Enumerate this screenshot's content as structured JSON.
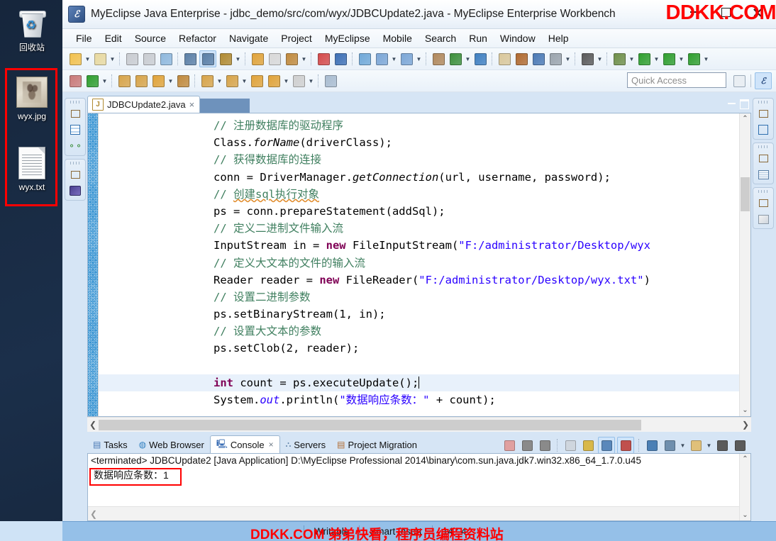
{
  "desktop": {
    "icons": [
      {
        "label": "回收站",
        "glyph": "recycle-bin"
      },
      {
        "label": "wyx.jpg",
        "glyph": "image-file"
      },
      {
        "label": "wyx.txt",
        "glyph": "text-file"
      }
    ]
  },
  "window": {
    "title": "MyEclipse Java Enterprise - jdbc_demo/src/com/wyx/JDBCUpdate2.java - MyEclipse Enterprise Workbench",
    "app_icon": "myeclipse-icon",
    "buttons": {
      "minimize": "minimize-button",
      "maximize": "maximize-button",
      "close": "close-button"
    }
  },
  "watermarks": {
    "title_bar": "DDKK.COM",
    "status_bar": "DDKK.COM 弟弟快看，程序员编程资料站"
  },
  "menu": {
    "items": [
      "File",
      "Edit",
      "Source",
      "Refactor",
      "Navigate",
      "Project",
      "MyEclipse",
      "Mobile",
      "Search",
      "Run",
      "Window",
      "Help"
    ]
  },
  "toolbar": {
    "quick_access_placeholder": "Quick Access",
    "row1": [
      {
        "name": "new-wizard",
        "color": "#f2c14e"
      },
      {
        "name": "dropdown-arrow",
        "arrow": true
      },
      {
        "name": "new-java-project",
        "color": "#e8d9a0"
      },
      {
        "name": "dropdown-arrow",
        "arrow": true
      },
      {
        "name": "separator",
        "sep": true
      },
      {
        "name": "save",
        "color": "#c9ccd1"
      },
      {
        "name": "save-all",
        "color": "#c9ccd1"
      },
      {
        "name": "print",
        "color": "#8fb8dd"
      },
      {
        "name": "separator",
        "sep": true
      },
      {
        "name": "run-mobile",
        "color": "#5b7fa6"
      },
      {
        "name": "debug-mobile",
        "color": "#5b7fa6",
        "active": true
      },
      {
        "name": "build-hammer",
        "color": "#b08a32"
      },
      {
        "name": "dropdown-arrow",
        "arrow": true
      },
      {
        "name": "separator",
        "sep": true
      },
      {
        "name": "undo",
        "color": "#e0a33a"
      },
      {
        "name": "redo",
        "color": "#d8d8d8"
      },
      {
        "name": "deploy",
        "color": "#c08a3e"
      },
      {
        "name": "dropdown-arrow",
        "arrow": true
      },
      {
        "name": "separator",
        "sep": true
      },
      {
        "name": "new-server-cube",
        "color": "#d44a4a"
      },
      {
        "name": "server-cube",
        "color": "#3c6fb5"
      },
      {
        "name": "separator",
        "sep": true
      },
      {
        "name": "web-20",
        "color": "#6fa8d8"
      },
      {
        "name": "new-diagram",
        "color": "#7ba6d6"
      },
      {
        "name": "dropdown-arrow",
        "arrow": true
      },
      {
        "name": "open-diagram",
        "color": "#7ba6d6"
      },
      {
        "name": "dropdown-arrow",
        "arrow": true
      },
      {
        "name": "separator",
        "sep": true
      },
      {
        "name": "import-project",
        "color": "#b0885c"
      },
      {
        "name": "run-server",
        "color": "#3c8f3c"
      },
      {
        "name": "dropdown-arrow",
        "arrow": true
      },
      {
        "name": "globe",
        "color": "#3e7fc1"
      },
      {
        "name": "separator",
        "sep": true
      },
      {
        "name": "clean",
        "color": "#d9c79a"
      },
      {
        "name": "refresh-reverse",
        "color": "#b06a30"
      },
      {
        "name": "report",
        "color": "#4a79b5"
      },
      {
        "name": "hidden-view",
        "color": "#9aa4ad"
      },
      {
        "name": "dropdown-arrow",
        "arrow": true
      },
      {
        "name": "separator",
        "sep": true
      },
      {
        "name": "snapshot",
        "color": "#5a5a5a"
      },
      {
        "name": "dropdown-arrow",
        "arrow": true
      },
      {
        "name": "separator",
        "sep": true
      },
      {
        "name": "debug",
        "color": "#6f8f4a"
      },
      {
        "name": "dropdown-arrow",
        "arrow": true
      },
      {
        "name": "run",
        "color": "#2f9e2f"
      },
      {
        "name": "dropdown-arrow",
        "arrow": true
      },
      {
        "name": "run-configurations",
        "color": "#2f9e2f"
      },
      {
        "name": "dropdown-arrow",
        "arrow": true
      },
      {
        "name": "run-external",
        "color": "#2f9e2f"
      },
      {
        "name": "dropdown-arrow",
        "arrow": true
      }
    ],
    "row2": [
      {
        "name": "new-table",
        "color": "#c97a7a"
      },
      {
        "name": "new-green-circle",
        "color": "#2f9e2f"
      },
      {
        "name": "dropdown-arrow",
        "arrow": true
      },
      {
        "name": "separator",
        "sep": true
      },
      {
        "name": "open-folder-green",
        "color": "#d7a44a"
      },
      {
        "name": "open-folder",
        "color": "#d7a44a"
      },
      {
        "name": "pencil",
        "color": "#e0a33a"
      },
      {
        "name": "dropdown-arrow",
        "arrow": true
      },
      {
        "name": "open-resource",
        "color": "#c08a3e"
      },
      {
        "name": "separator",
        "sep": true
      },
      {
        "name": "next-annotation",
        "color": "#d7a44a"
      },
      {
        "name": "dropdown-arrow",
        "arrow": true
      },
      {
        "name": "previous-annotation",
        "color": "#d7a44a"
      },
      {
        "name": "dropdown-arrow",
        "arrow": true
      },
      {
        "name": "back-history",
        "color": "#e0a33a"
      },
      {
        "name": "back",
        "color": "#e0a33a"
      },
      {
        "name": "dropdown-arrow",
        "arrow": true
      },
      {
        "name": "forward",
        "color": "#cfcfcf"
      },
      {
        "name": "dropdown-arrow",
        "arrow": true
      },
      {
        "name": "separator",
        "sep": true
      },
      {
        "name": "new-window",
        "color": "#a9bcd0"
      }
    ]
  },
  "left_side_icons": [
    {
      "name": "restore-view-icon"
    },
    {
      "name": "package-explorer-icon"
    },
    {
      "name": "outline-tree-icon"
    },
    {
      "name": "restore-view-icon-2"
    },
    {
      "name": "myeclipse-explorer-icon"
    }
  ],
  "right_side_icons": [
    {
      "name": "restore-view-icon"
    },
    {
      "name": "outline-icon"
    },
    {
      "name": "restore-view-icon-2"
    },
    {
      "name": "task-list-icon"
    },
    {
      "name": "restore-view-icon-3"
    },
    {
      "name": "snippets-icon"
    }
  ],
  "editor": {
    "tab_label": "JDBCUpdate2.java",
    "tab_icon": "java-file-icon",
    "tab_close": "×",
    "code_lines": [
      {
        "indent": 0,
        "tokens": [
          {
            "t": "comment",
            "v": "// "
          },
          {
            "t": "comment",
            "v": "注册数据库的驱动程序"
          }
        ]
      },
      {
        "indent": 0,
        "tokens": [
          {
            "t": "plain",
            "v": "Class."
          },
          {
            "t": "method",
            "v": "forName"
          },
          {
            "t": "plain",
            "v": "(driverClass);"
          }
        ]
      },
      {
        "indent": 0,
        "tokens": [
          {
            "t": "comment",
            "v": "// "
          },
          {
            "t": "comment",
            "v": "获得数据库的连接"
          }
        ]
      },
      {
        "indent": 0,
        "tokens": [
          {
            "t": "plain",
            "v": "conn = DriverManager."
          },
          {
            "t": "method",
            "v": "getConnection"
          },
          {
            "t": "plain",
            "v": "(url, username, password);"
          }
        ]
      },
      {
        "indent": 0,
        "tokens": [
          {
            "t": "comment",
            "v": "// "
          },
          {
            "t": "comment-spell",
            "v": "创建sql执行对象"
          }
        ]
      },
      {
        "indent": 0,
        "tokens": [
          {
            "t": "plain",
            "v": "ps = conn.prepareStatement(addSql);"
          }
        ]
      },
      {
        "indent": 0,
        "tokens": [
          {
            "t": "comment",
            "v": "// "
          },
          {
            "t": "comment",
            "v": "定义二进制文件输入流"
          }
        ]
      },
      {
        "indent": 0,
        "tokens": [
          {
            "t": "plain",
            "v": "InputStream in = "
          },
          {
            "t": "keyword",
            "v": "new"
          },
          {
            "t": "plain",
            "v": " FileInputStream("
          },
          {
            "t": "string",
            "v": "\"F:/administrator/Desktop/wyx"
          }
        ]
      },
      {
        "indent": 0,
        "tokens": [
          {
            "t": "comment",
            "v": "// "
          },
          {
            "t": "comment",
            "v": "定义大文本的文件的输入流"
          }
        ]
      },
      {
        "indent": 0,
        "tokens": [
          {
            "t": "plain",
            "v": "Reader reader = "
          },
          {
            "t": "keyword",
            "v": "new"
          },
          {
            "t": "plain",
            "v": " FileReader("
          },
          {
            "t": "string",
            "v": "\"F:/administrator/Desktop/wyx.txt\""
          },
          {
            "t": "plain",
            "v": ")"
          }
        ]
      },
      {
        "indent": 0,
        "tokens": [
          {
            "t": "comment",
            "v": "// "
          },
          {
            "t": "comment",
            "v": "设置二进制参数"
          }
        ]
      },
      {
        "indent": 0,
        "tokens": [
          {
            "t": "plain",
            "v": "ps.setBinaryStream(1, in);"
          }
        ]
      },
      {
        "indent": 0,
        "tokens": [
          {
            "t": "comment",
            "v": "// "
          },
          {
            "t": "comment",
            "v": "设置大文本的参数"
          }
        ]
      },
      {
        "indent": 0,
        "tokens": [
          {
            "t": "plain",
            "v": "ps.setClob(2, reader);"
          }
        ]
      },
      {
        "indent": 0,
        "tokens": []
      },
      {
        "indent": 0,
        "highlight": true,
        "caret": true,
        "tokens": [
          {
            "t": "keyword",
            "v": "int"
          },
          {
            "t": "plain",
            "v": " count = ps.executeUpdate();"
          }
        ]
      },
      {
        "indent": 0,
        "tokens": [
          {
            "t": "plain",
            "v": "System."
          },
          {
            "t": "field",
            "v": "out"
          },
          {
            "t": "plain",
            "v": ".println("
          },
          {
            "t": "string",
            "v": "\"数据响应条数："
          },
          {
            "t": "string",
            "v": "\""
          },
          {
            "t": "plain",
            "v": " + count);"
          }
        ]
      }
    ]
  },
  "console": {
    "tabs": [
      {
        "label": "Tasks",
        "icon": "tasks-icon",
        "active": false
      },
      {
        "label": "Web Browser",
        "icon": "browser-icon",
        "active": false
      },
      {
        "label": "Console",
        "icon": "console-icon",
        "active": true,
        "closeable": true
      },
      {
        "label": "Servers",
        "icon": "servers-icon",
        "active": false
      },
      {
        "label": "Project Migration",
        "icon": "migration-icon",
        "active": false
      }
    ],
    "tools": [
      {
        "name": "terminate-icon",
        "color": "#e0a0a0"
      },
      {
        "name": "remove-launch-icon",
        "color": "#8a8a8a"
      },
      {
        "name": "remove-all-terminated-icon",
        "color": "#8a8a8a"
      },
      {
        "name": "separator",
        "sep": true
      },
      {
        "name": "clear-console-icon",
        "color": "#cfd6de"
      },
      {
        "name": "scroll-lock-icon",
        "color": "#d8b84a"
      },
      {
        "name": "show-console-on-output-icon",
        "color": "#5a88bb",
        "active": true
      },
      {
        "name": "show-console-on-error-icon",
        "color": "#c0504d",
        "active": true
      },
      {
        "name": "separator",
        "sep": true
      },
      {
        "name": "pin-console-icon",
        "color": "#4a7fb5"
      },
      {
        "name": "display-selected-console-icon",
        "color": "#6f8fae"
      },
      {
        "name": "dropdown-arrow",
        "arrow": true
      },
      {
        "name": "open-console-icon",
        "color": "#e0c07a"
      },
      {
        "name": "dropdown-arrow",
        "arrow": true
      },
      {
        "name": "minimize-view-icon",
        "color": "#5a5a5a"
      },
      {
        "name": "maximize-view-icon",
        "color": "#5a5a5a"
      }
    ],
    "launch_line": "<terminated> JDBCUpdate2 [Java Application] D:\\MyEclipse Professional 2014\\binary\\com.sun.java.jdk7.win32.x86_64_1.7.0.u45",
    "output": "数据响应条数：1"
  },
  "statusbar": {
    "writable": "Writable",
    "insert_mode": "Smart Insert",
    "position": "14 : 4"
  },
  "colors": {
    "accent_blue": "#3c6fb5",
    "status_bar": "#95c0e8",
    "highlight_line": "#e8f1fb",
    "watermark_red": "#ff0000",
    "comment_green": "#3f7f5f",
    "string_blue": "#2a00ff",
    "keyword_purple": "#7f0055"
  }
}
